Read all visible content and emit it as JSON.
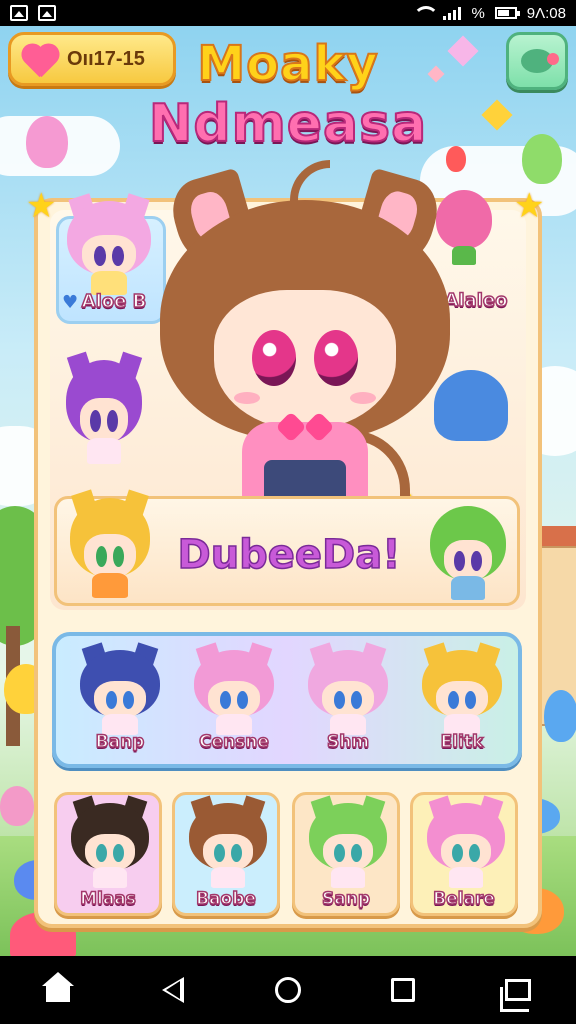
{
  "status_bar": {
    "right_text": "% ",
    "time": "9Λ:08"
  },
  "header": {
    "date": "Oıı17-15",
    "title_line1": "Moaky",
    "title_line2": "Ndmeasa"
  },
  "hero": {
    "left_top_name": "Aloe B",
    "right_top_name": "Alaleo",
    "featured_label": "DubeeDa!"
  },
  "row2": {
    "items": [
      {
        "name": "Banp",
        "hair": "#3e4fb0"
      },
      {
        "name": "Censne",
        "hair": "#f29ad6"
      },
      {
        "name": "Shm",
        "hair": "#f0a8e0"
      },
      {
        "name": "Elitk",
        "hair": "#f6c23a"
      }
    ]
  },
  "row3": {
    "items": [
      {
        "name": "Mlaas",
        "hair": "#3a2a22",
        "bg": "#f7cdef"
      },
      {
        "name": "Baobe",
        "hair": "#9a5a34",
        "bg": "#cbeefd"
      },
      {
        "name": "Sanp",
        "hair": "#7cd05a",
        "bg": "#fde6c6"
      },
      {
        "name": "Belare",
        "hair": "#f38ed0",
        "bg": "#fdf0b8"
      }
    ]
  },
  "colors": {
    "accent_pink": "#ff6fb0",
    "accent_yellow": "#ffd21a",
    "frame": "#f2c27a"
  }
}
